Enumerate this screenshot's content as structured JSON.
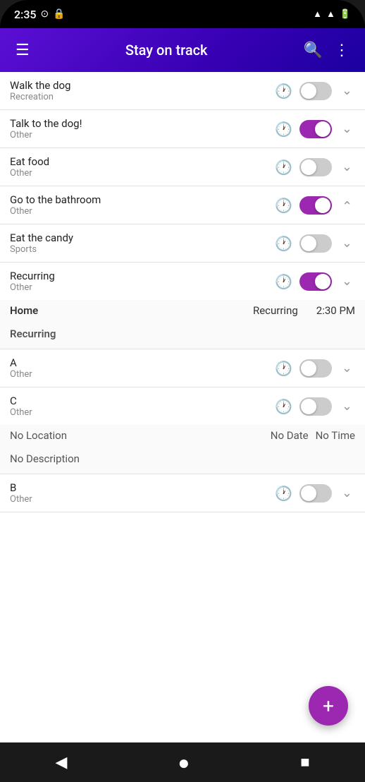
{
  "status": {
    "time": "2:35",
    "icons": [
      "●",
      "●",
      "▲",
      "█"
    ]
  },
  "appBar": {
    "title": "Stay on track",
    "menuIcon": "☰",
    "searchIcon": "🔍",
    "moreIcon": "⋮"
  },
  "tasks": [
    {
      "id": "walk-the-dog",
      "name": "Walk the dog",
      "category": "Recreation",
      "toggleOn": false,
      "expanded": false,
      "showChevronUp": false
    },
    {
      "id": "talk-to-the-dog",
      "name": "Talk to the dog!",
      "category": "Other",
      "toggleOn": true,
      "expanded": false,
      "showChevronUp": false
    },
    {
      "id": "eat-food",
      "name": "Eat food",
      "category": "Other",
      "toggleOn": false,
      "expanded": false,
      "showChevronUp": false
    },
    {
      "id": "go-to-bathroom",
      "name": "Go to the bathroom",
      "category": "Other",
      "toggleOn": true,
      "expanded": true,
      "showChevronUp": true,
      "expandedData": null
    },
    {
      "id": "eat-the-candy",
      "name": "Eat the candy",
      "category": "Sports",
      "toggleOn": false,
      "expanded": false,
      "showChevronUp": false
    },
    {
      "id": "recurring",
      "name": "Recurring",
      "category": "Other",
      "toggleOn": true,
      "expanded": true,
      "showChevronUp": false,
      "expandedData": {
        "location": "Home",
        "recurring": "Recurring",
        "time": "2:30 PM",
        "recurringLabel": "Recurring"
      }
    },
    {
      "id": "a",
      "name": "A",
      "category": "Other",
      "toggleOn": false,
      "expanded": false,
      "showChevronUp": false
    },
    {
      "id": "c",
      "name": "C",
      "category": "Other",
      "toggleOn": false,
      "expanded": true,
      "showChevronUp": false,
      "expandedData": {
        "location": "No Location",
        "recurring": "No Date",
        "time": "No Time",
        "recurringLabel": "No Description"
      }
    },
    {
      "id": "b",
      "name": "B",
      "category": "Other",
      "toggleOn": false,
      "expanded": false,
      "showChevronUp": false
    }
  ],
  "fab": {
    "icon": "+",
    "label": "Add task"
  },
  "bottomNav": {
    "back": "◀",
    "home": "●",
    "square": "■"
  }
}
